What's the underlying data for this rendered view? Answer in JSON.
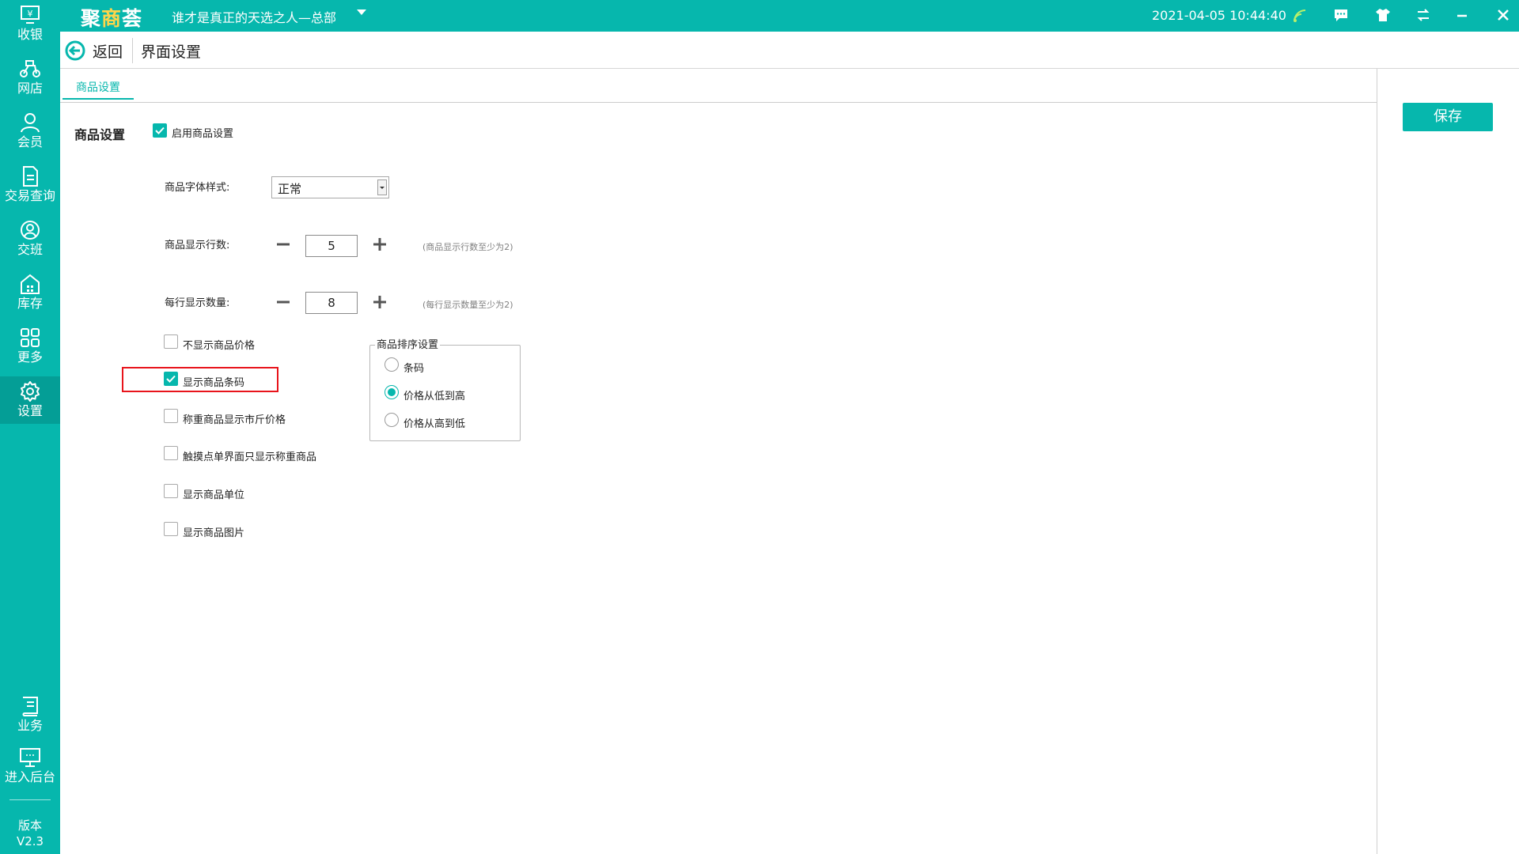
{
  "app": {
    "logo_part1": "聚",
    "logo_part2": "商",
    "logo_part3": "荟",
    "store_name": "谁才是真正的天选之人—总部",
    "datetime": "2021-04-05 10:44:40",
    "accent_color": "#06b7ad"
  },
  "sidebar": {
    "items": [
      {
        "label": "收银",
        "icon": "cashier-icon"
      },
      {
        "label": "网店",
        "icon": "scooter-icon"
      },
      {
        "label": "会员",
        "icon": "member-icon"
      },
      {
        "label": "交易查询",
        "icon": "document-icon"
      },
      {
        "label": "交班",
        "icon": "shift-icon"
      },
      {
        "label": "库存",
        "icon": "warehouse-icon"
      },
      {
        "label": "更多",
        "icon": "grid-icon"
      },
      {
        "label": "设置",
        "icon": "gear-icon",
        "active": true
      }
    ],
    "bottom_items": [
      {
        "label": "业务",
        "icon": "book-icon"
      },
      {
        "label": "进入后台",
        "icon": "monitor-icon"
      }
    ],
    "version_label": "版本",
    "version_value": "V2.3"
  },
  "subheader": {
    "back_label": "返回",
    "title": "界面设置"
  },
  "tabs": [
    {
      "label": "商品设置",
      "active": true
    }
  ],
  "save_label": "保存",
  "settings": {
    "section_label": "商品设置",
    "enable_label": "启用商品设置",
    "enable_checked": true,
    "font_style_label": "商品字体样式:",
    "font_style_value": "正常",
    "rows_label": "商品显示行数:",
    "rows_value": "5",
    "rows_hint": "(商品显示行数至少为2)",
    "per_row_label": "每行显示数量:",
    "per_row_value": "8",
    "per_row_hint": "(每行显示数量至少为2)",
    "options": [
      {
        "label": "不显示商品价格",
        "checked": false
      },
      {
        "label": "显示商品条码",
        "checked": true
      },
      {
        "label": "称重商品显示市斤价格",
        "checked": false
      },
      {
        "label": "触摸点单界面只显示称重商品",
        "checked": false
      },
      {
        "label": "显示商品单位",
        "checked": false
      },
      {
        "label": "显示商品图片",
        "checked": false
      }
    ],
    "sort_group": {
      "legend": "商品排序设置",
      "options": [
        {
          "label": "条码",
          "selected": false
        },
        {
          "label": "价格从低到高",
          "selected": true
        },
        {
          "label": "价格从高到低",
          "selected": false
        }
      ]
    }
  }
}
